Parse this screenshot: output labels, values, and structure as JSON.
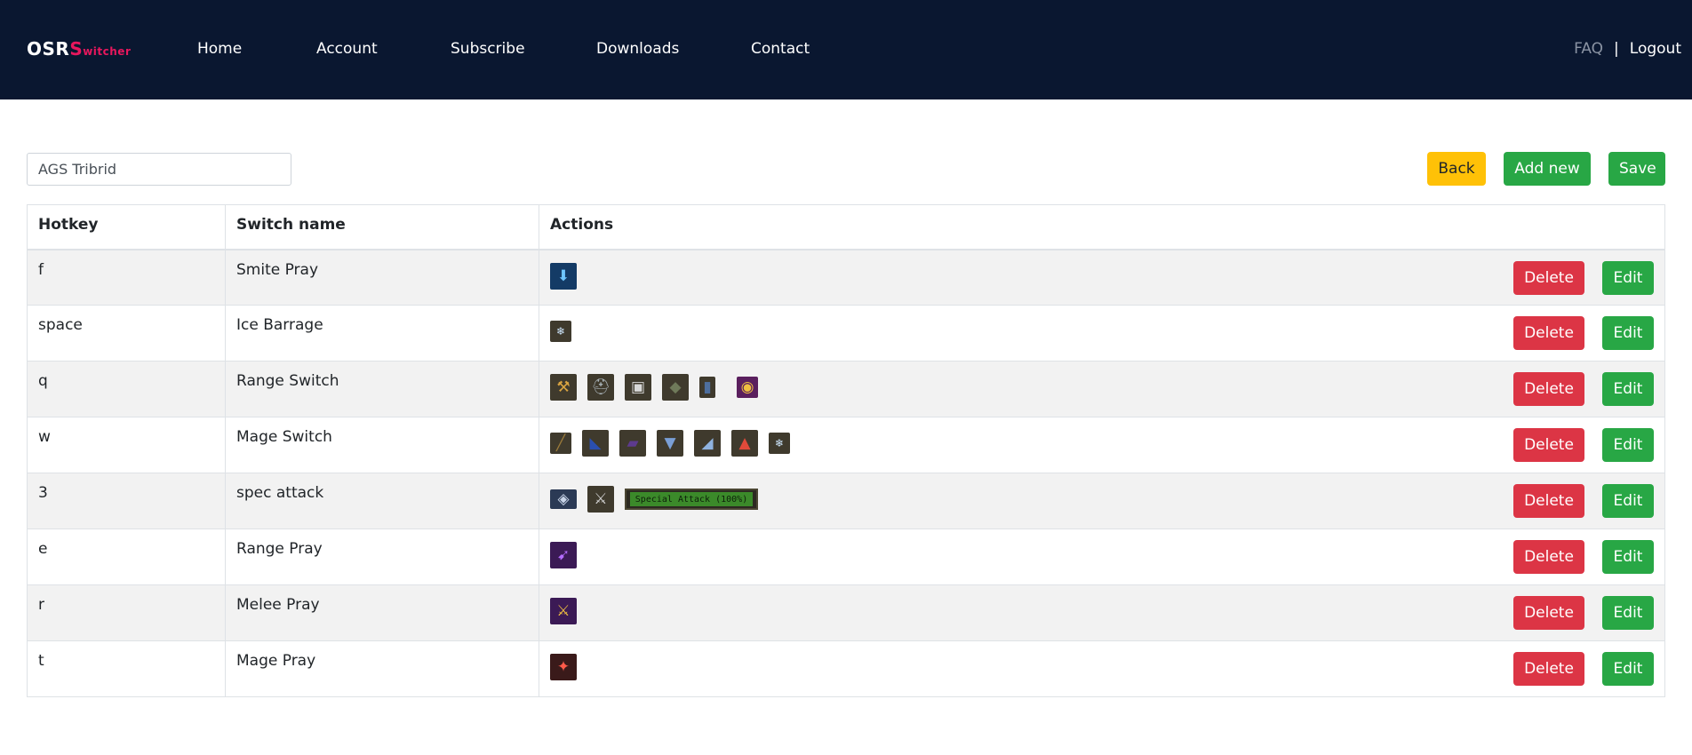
{
  "brand": {
    "part1": "OSR",
    "part2": "S",
    "part3": "witcher"
  },
  "nav": {
    "home": "Home",
    "account": "Account",
    "subscribe": "Subscribe",
    "downloads": "Downloads",
    "contact": "Contact"
  },
  "nav_right": {
    "faq": "FAQ",
    "separator": "|",
    "logout": "Logout"
  },
  "switch_set": {
    "name": "AGS Tribrid"
  },
  "toolbar": {
    "back": "Back",
    "add_new": "Add new",
    "save": "Save"
  },
  "table": {
    "headers": {
      "hotkey": "Hotkey",
      "switch_name": "Switch name",
      "actions": "Actions"
    },
    "delete_label": "Delete",
    "edit_label": "Edit",
    "rows": [
      {
        "hotkey": "f",
        "name": "Smite Pray"
      },
      {
        "hotkey": "space",
        "name": "Ice Barrage"
      },
      {
        "hotkey": "q",
        "name": "Range Switch"
      },
      {
        "hotkey": "w",
        "name": "Mage Switch"
      },
      {
        "hotkey": "3",
        "name": "spec attack",
        "spec_text": "Special Attack (100%)",
        "spec_level_percent": 100
      },
      {
        "hotkey": "e",
        "name": "Range Pray"
      },
      {
        "hotkey": "r",
        "name": "Melee Pray"
      },
      {
        "hotkey": "t",
        "name": "Mage Pray"
      }
    ]
  },
  "colors": {
    "header_bg": "#0a1730",
    "brand_accent": "#e8175d",
    "success": "#28a745",
    "danger": "#dc3545",
    "warning": "#ffc107"
  }
}
